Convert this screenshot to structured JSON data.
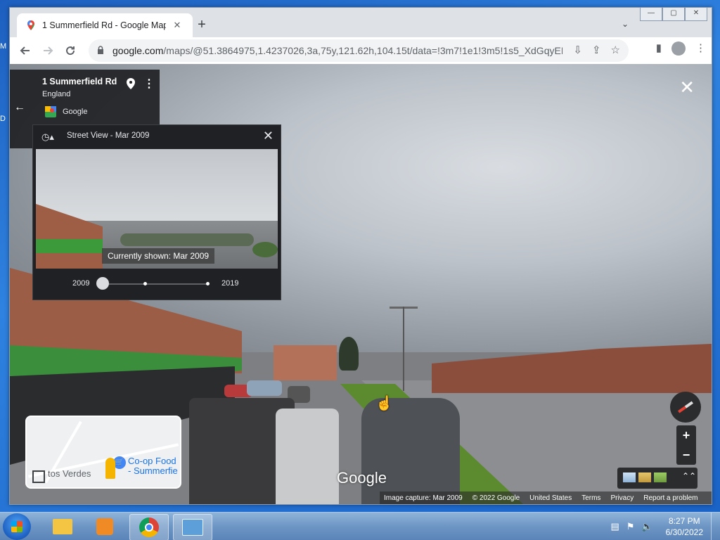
{
  "desktop": {
    "edge_text_1": "M",
    "edge_text_2": "D"
  },
  "browser": {
    "tab_title": "1 Summerfield Rd - Google Map",
    "tab_close": "✕",
    "new_tab": "+",
    "tab_search": "⌄",
    "window_controls": [
      "—",
      "▢",
      "✕"
    ],
    "url_host": "google.com",
    "url_rest": "/maps/@51.3864975,1.4237026,3a,75y,121.62h,104.15t/data=!3m7!1e1!3m5!1s5_XdGqyEK...",
    "icons": [
      "back-icon",
      "forward-icon",
      "reload-icon",
      "lock-icon",
      "install-icon",
      "share-icon",
      "star-icon",
      "sidepanel-icon",
      "profile-icon",
      "menu-icon"
    ]
  },
  "place_card": {
    "title": "1 Summerfield Rd",
    "subtitle": "England",
    "source": "Google"
  },
  "time_travel": {
    "title": "Street View - Mar 2009",
    "currently_shown": "Currently shown: Mar 2009",
    "year_start": "2009",
    "year_end": "2019",
    "selected_position": 0
  },
  "minimap": {
    "poi_label_1": "Co-op Food",
    "poi_label_2": "- Summerfie",
    "left_label": "tos Verdes"
  },
  "streetview": {
    "logo": "Google",
    "zoom_in": "+",
    "zoom_out": "−",
    "footer": [
      "Image capture: Mar 2009",
      "© 2022 Google",
      "United States",
      "Terms",
      "Privacy",
      "Report a problem"
    ]
  },
  "taskbar": {
    "time": "8:27 PM",
    "date": "6/30/2022"
  },
  "colors": {
    "panel_bg": "#202124",
    "chrome_frame": "#dee1e6",
    "taskbar": "#6d95c4"
  }
}
